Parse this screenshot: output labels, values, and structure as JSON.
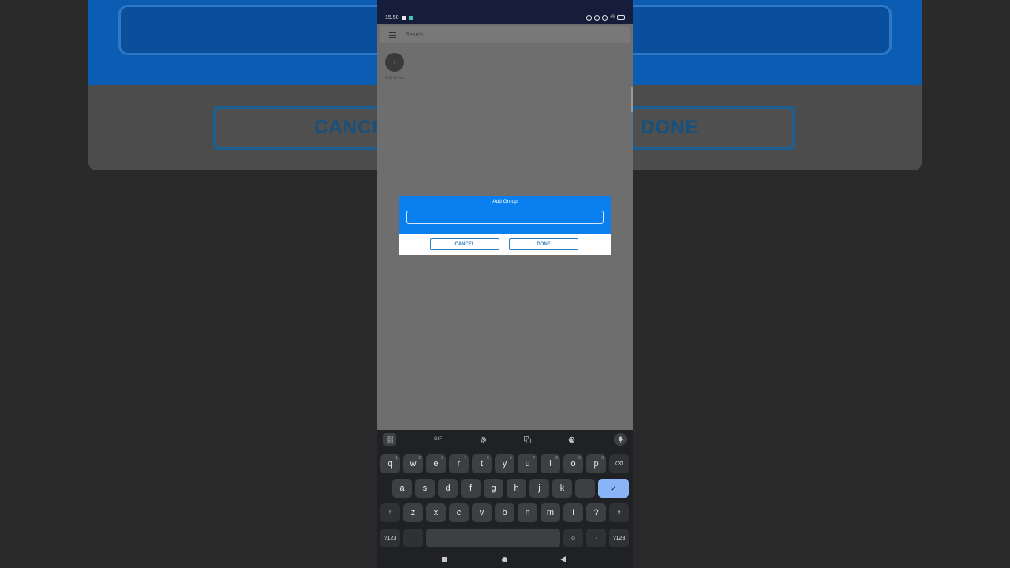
{
  "background_zoom": {
    "cancel_label": "CANCEL",
    "done_label": "DONE"
  },
  "status_bar": {
    "time": "15.50",
    "network": "⁴ᴳ"
  },
  "app_bar": {
    "search_placeholder": "Search..."
  },
  "groups": {
    "add_label": "Add Group",
    "add_symbol": "+"
  },
  "dialog": {
    "title": "Add Group",
    "input_value": "",
    "cancel_label": "CANCEL",
    "done_label": "DONE"
  },
  "keyboard": {
    "toolbar": {
      "gif_label": "GIF"
    },
    "row1": [
      {
        "k": "q",
        "h": "1"
      },
      {
        "k": "w",
        "h": "2"
      },
      {
        "k": "e",
        "h": "3"
      },
      {
        "k": "r",
        "h": "4"
      },
      {
        "k": "t",
        "h": "5"
      },
      {
        "k": "y",
        "h": "6"
      },
      {
        "k": "u",
        "h": "7"
      },
      {
        "k": "i",
        "h": "8"
      },
      {
        "k": "o",
        "h": "9"
      },
      {
        "k": "p",
        "h": "0"
      }
    ],
    "row2": [
      "a",
      "s",
      "d",
      "f",
      "g",
      "h",
      "j",
      "k",
      "l"
    ],
    "row3": [
      "z",
      "x",
      "c",
      "v",
      "b",
      "n",
      "m",
      "!",
      "?"
    ],
    "symbols_label": "?123",
    "comma": ",",
    "period": "·",
    "emoji_symbol": "☺",
    "shift_symbol": "⇧",
    "enter_symbol": "✓",
    "backspace_symbol": "⌫"
  },
  "colors": {
    "dialog_blue": "#0a7ff0",
    "button_outline": "#2a7bbf",
    "enter_key": "#8ab4f8"
  }
}
